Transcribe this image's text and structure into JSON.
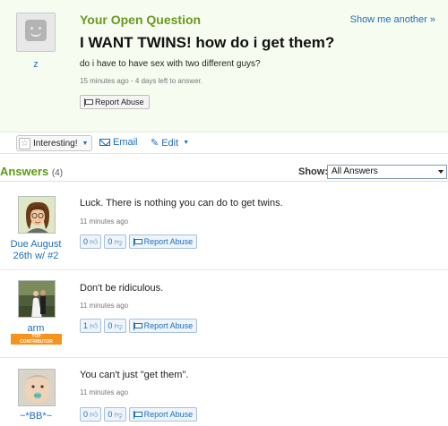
{
  "question": {
    "asker_name": "z",
    "label": "Your Open Question",
    "show_another": "Show me another »",
    "title": "I WANT TWINS! how do i get them?",
    "details": "do i have to have sex with two different guys?",
    "time_info": "15 minutes ago - 4 days left to answer.",
    "report_label": "Report Abuse"
  },
  "actions": {
    "interesting_label": "Interesting!",
    "email_label": "Email",
    "edit_label": "Edit"
  },
  "answers_header": {
    "title": "Answers",
    "count": "(4)",
    "show_label": "Show:",
    "show_selected": "All Answers"
  },
  "answers": [
    {
      "user": "Due August 26th w/ #2",
      "text": "Luck. There is nothing you can do to get twins.",
      "time": "11 minutes ago",
      "thumbs_up": "0",
      "thumbs_down": "0",
      "report_label": "Report Abuse",
      "badge": ""
    },
    {
      "user": "arm",
      "text": "Don't be ridiculous.",
      "time": "11 minutes ago",
      "thumbs_up": "1",
      "thumbs_down": "0",
      "report_label": "Report Abuse",
      "badge_line1": "TOP",
      "badge_line2": "CONTRIBUTOR"
    },
    {
      "user": "~*BB*~",
      "text": "You can't just \"get them\".",
      "time": "11 minutes ago",
      "thumbs_up": "0",
      "thumbs_down": "0",
      "report_label": "Report Abuse",
      "badge": ""
    }
  ],
  "colors": {
    "accent_green": "#5a9b14",
    "link_blue": "#1d6fb8",
    "question_bg": "#f7fcf0",
    "badge_orange": "#f6921e"
  },
  "icons": [
    "default-avatar-icon",
    "flag-icon",
    "star-icon",
    "envelope-icon",
    "pencil-icon",
    "thumb-up-icon",
    "thumb-down-icon"
  ]
}
